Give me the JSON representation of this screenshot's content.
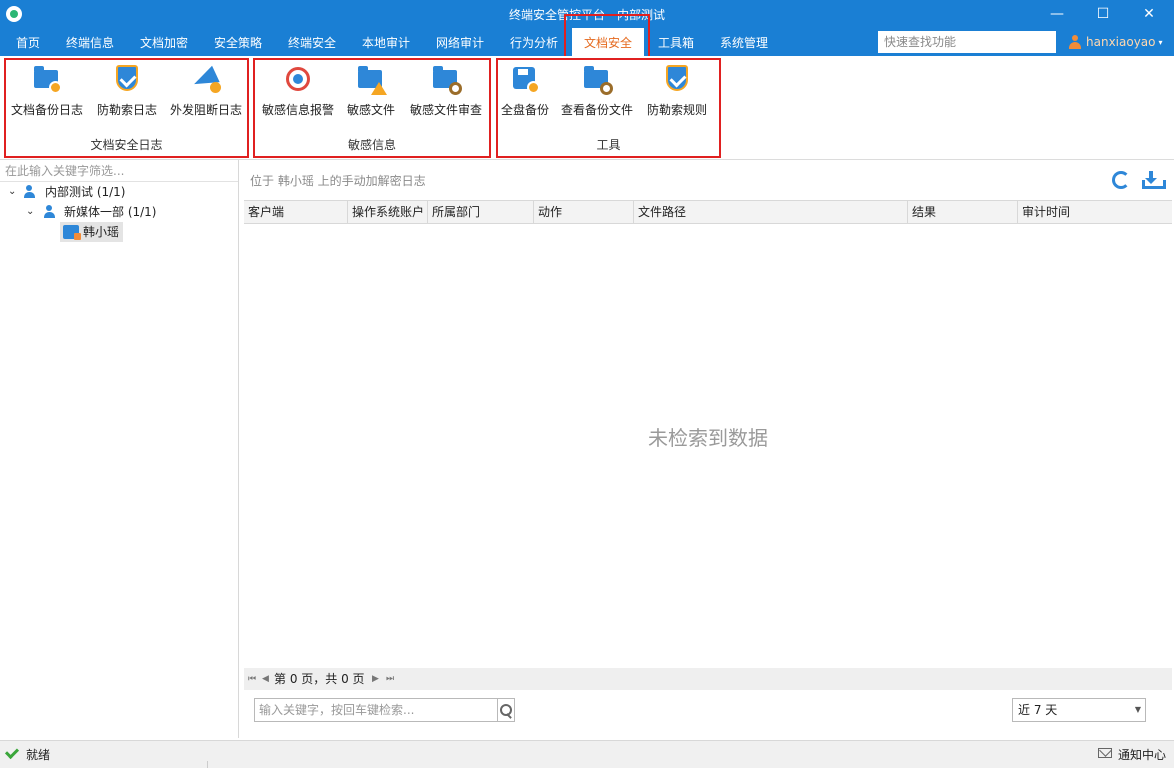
{
  "window": {
    "title": "终端安全管控平台 - 内部测试",
    "minimize_glyph": "—",
    "maximize_glyph": "☐",
    "close_glyph": "✕"
  },
  "nav": {
    "tabs": [
      "首页",
      "终端信息",
      "文档加密",
      "安全策略",
      "终端安全",
      "本地审计",
      "网络审计",
      "行为分析",
      "文档安全",
      "工具箱",
      "系统管理"
    ],
    "active_tab": "文档安全",
    "quick_search_placeholder": "快速查找功能",
    "user_name": "hanxiaoyao"
  },
  "ribbon": {
    "groups": [
      {
        "label": "文档安全日志",
        "buttons": [
          {
            "label": "文档备份日志",
            "icon": "folder-backup-icon"
          },
          {
            "label": "防勒索日志",
            "icon": "shield-check-icon"
          },
          {
            "label": "外发阻断日志",
            "icon": "paper-plane-block-icon"
          }
        ]
      },
      {
        "label": "敏感信息",
        "buttons": [
          {
            "label": "敏感信息报警",
            "icon": "target-alarm-icon"
          },
          {
            "label": "敏感文件",
            "icon": "folder-warning-icon"
          },
          {
            "label": "敏感文件审查",
            "icon": "folder-search-icon"
          }
        ]
      },
      {
        "label": "工具",
        "buttons": [
          {
            "label": "全盘备份",
            "icon": "disk-backup-icon"
          },
          {
            "label": "查看备份文件",
            "icon": "folder-search-icon"
          },
          {
            "label": "防勒索规则",
            "icon": "shield-rule-icon"
          }
        ]
      }
    ]
  },
  "tree": {
    "filter_placeholder": "在此输入关键字筛选...",
    "nodes": [
      {
        "label": "内部测试 (1/1)",
        "toggle": "⌄"
      },
      {
        "label": "新媒体一部 (1/1)",
        "toggle": "⌄"
      },
      {
        "label": "韩小瑶"
      }
    ]
  },
  "main": {
    "location_text": "位于 韩小瑶 上的手动加解密日志",
    "columns": [
      "客户端",
      "操作系统账户",
      "所属部门",
      "动作",
      "文件路径",
      "结果",
      "审计时间"
    ],
    "empty_text": "未检索到数据",
    "pager": {
      "first": "⏮",
      "prev": "◀",
      "next": "▶",
      "last": "⏭",
      "text": "第 0 页，共 0 页"
    },
    "search_placeholder": "输入关键字，按回车键检索...",
    "range_value": "近 7 天"
  },
  "status": {
    "text": "就绪",
    "notice": "通知中心"
  },
  "colors": {
    "brand": "#1a7fd4",
    "active_tab_text": "#e56a1f",
    "highlight_border": "#e02020"
  }
}
